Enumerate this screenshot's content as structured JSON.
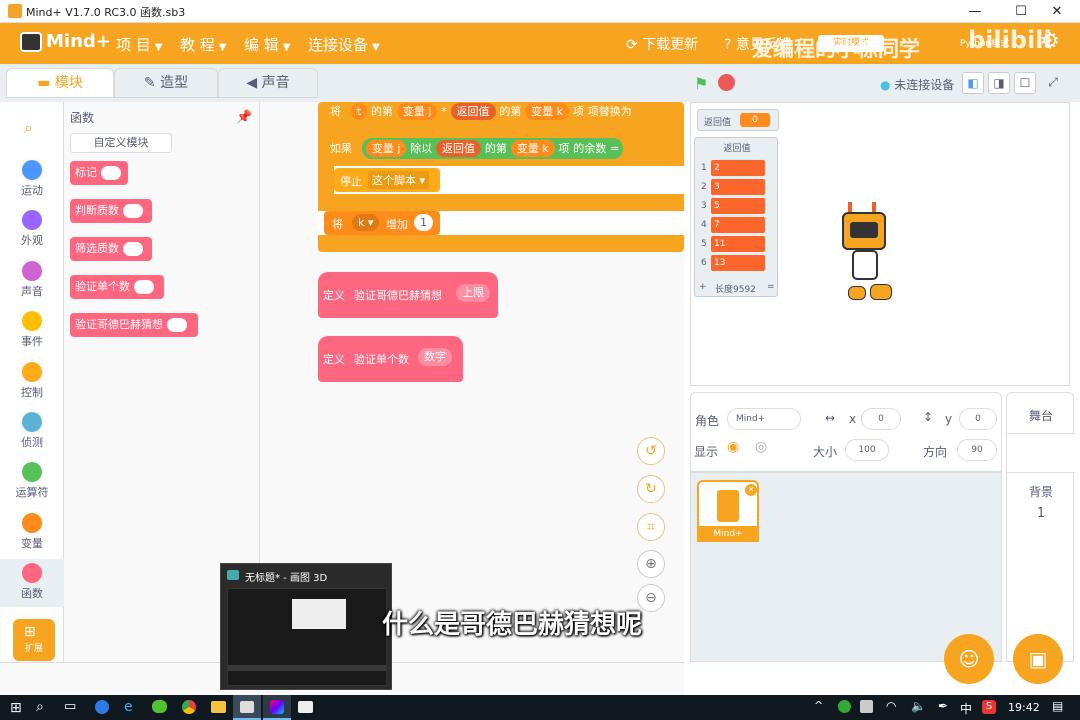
{
  "window": {
    "title": "Mind+ V1.7.0 RC3.0   函数.sb3",
    "minimize": "—",
    "maximize": "☐",
    "close": "✕"
  },
  "menu": {
    "logo": "Mind+",
    "items": [
      "项 目",
      "教 程",
      "编 辑",
      "连接设备"
    ],
    "update": "下载更新",
    "feedback": "意见反馈",
    "mode_button": "实时模式",
    "python": "Python模式",
    "watermark": "爱编程的小栋同学",
    "watermark_bili": "bilibili"
  },
  "tabs": {
    "blocks": "模块",
    "costumes": "造型",
    "sounds": "声音"
  },
  "categories": [
    {
      "label": "运动",
      "color": "#4c97ff"
    },
    {
      "label": "外观",
      "color": "#9966ff"
    },
    {
      "label": "声音",
      "color": "#cf63cf"
    },
    {
      "label": "事件",
      "color": "#ffbf00"
    },
    {
      "label": "控制",
      "color": "#ffab19"
    },
    {
      "label": "侦测",
      "color": "#5cb1d6"
    },
    {
      "label": "运算符",
      "color": "#59c059"
    },
    {
      "label": "变量",
      "color": "#ff8c1a"
    },
    {
      "label": "函数",
      "color": "#ff6680"
    }
  ],
  "extension": "扩展",
  "palette": {
    "title": "函数",
    "make_block": "自定义模块",
    "blocks": [
      "标记",
      "判断质数",
      "筛选质数",
      "验证单个数",
      "验证哥德巴赫猜想"
    ]
  },
  "script": {
    "row1": {
      "set": "将",
      "var": "t",
      "of": "的第",
      "item1": "变量 j",
      "op": "*",
      "list": "返回值",
      "of2": "的第",
      "item2": "变量 k",
      "item_word": "项",
      "replace": "项替换为"
    },
    "row2": {
      "if": "如果",
      "a": "变量 j",
      "div": "除以",
      "list": "返回值",
      "of": "的第",
      "b": "变量 k",
      "rest": "项",
      "mod": "的余数",
      "eq": "="
    },
    "row3": {
      "stop": "停止",
      "which": "这个脚本"
    },
    "row4": {
      "change": "将",
      "var": "k",
      "inc": "增加",
      "val": "1"
    },
    "def1": {
      "kw": "定义",
      "name": "验证哥德巴赫猜想",
      "arg": "上限"
    },
    "def2": {
      "kw": "定义",
      "name": "验证单个数",
      "arg": "数字"
    }
  },
  "stage": {
    "monitor_label": "返回值",
    "monitor_value": "0",
    "list_title": "返回值",
    "list_items": [
      "2",
      "3",
      "5",
      "7",
      "11",
      "13"
    ],
    "list_length": "长度9592",
    "list_plus": "+",
    "list_eq": "=",
    "not_connected": "未连接设备"
  },
  "sprite": {
    "label": "角色",
    "name_ph": "Mind+",
    "x_label": "x",
    "x": "0",
    "y_label": "y",
    "y": "0",
    "show_label": "显示",
    "size_label": "大小",
    "size": "100",
    "dir_label": "方向",
    "dir": "90",
    "thumb_name": "Mind+"
  },
  "stage_panel": {
    "title": "舞台",
    "backdrop_label": "背景",
    "backdrop_count": "1"
  },
  "preview": {
    "title": "无标题* - 画图 3D"
  },
  "subtitle": "什么是哥德巴赫猜想呢",
  "taskbar": {
    "time": "19:42",
    "lang": "中",
    "ime": "S"
  }
}
